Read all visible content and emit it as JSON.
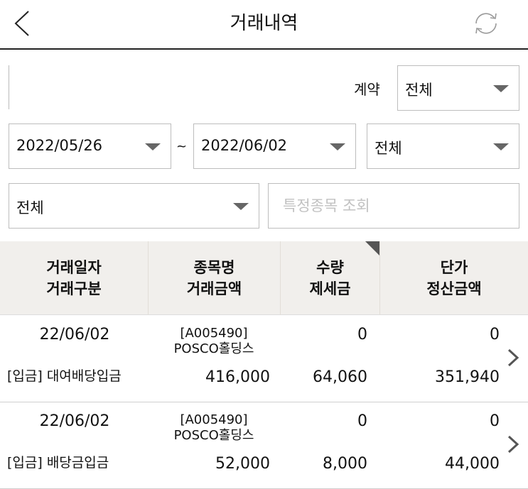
{
  "header": {
    "title": "거래내역",
    "back_icon": "chevron-left-icon",
    "refresh_icon": "refresh-icon"
  },
  "filters": {
    "contract_label": "계약",
    "contract_value": "전체",
    "start_date": "2022/05/26",
    "range_separator": "~",
    "end_date": "2022/06/02",
    "filter_a": "전체",
    "filter_b": "전체",
    "search_placeholder": "특정종목 조회"
  },
  "table": {
    "headers": [
      {
        "line1": "거래일자",
        "line2": "거래구분"
      },
      {
        "line1": "종목명",
        "line2": "거래금액"
      },
      {
        "line1": "수량",
        "line2": "제세금"
      },
      {
        "line1": "단가",
        "line2": "정산금액"
      }
    ],
    "rows": [
      {
        "date": "22/06/02",
        "type": "[입금] 대여배당입금",
        "code": "[A005490]",
        "name": "POSCO홀딩스",
        "amount": "416,000",
        "qty": "0",
        "tax": "64,060",
        "price": "0",
        "settle": "351,940"
      },
      {
        "date": "22/06/02",
        "type": "[입금] 배당금입금",
        "code": "[A005490]",
        "name": "POSCO홀딩스",
        "amount": "52,000",
        "qty": "0",
        "tax": "8,000",
        "price": "0",
        "settle": "44,000"
      }
    ]
  }
}
